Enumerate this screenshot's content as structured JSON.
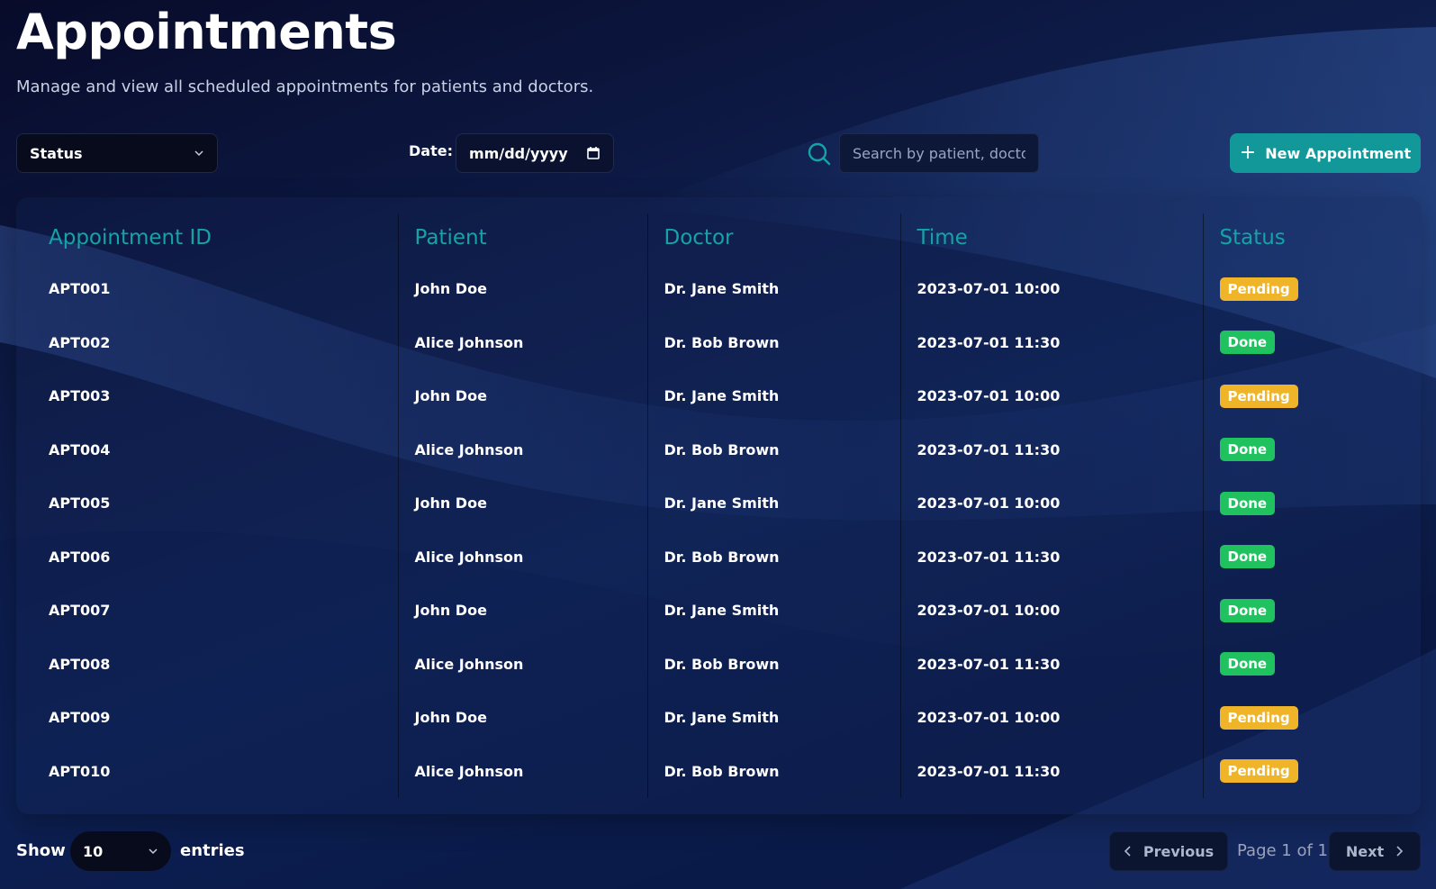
{
  "header": {
    "title": "Appointments",
    "subtitle": "Manage and view all scheduled appointments for patients and doctors."
  },
  "toolbar": {
    "status_filter": {
      "value": "Status",
      "icon": "chevron-down-icon"
    },
    "date_label": "Date:",
    "date_value": "mm/dd/yyyy",
    "date_icon": "calendar-icon",
    "search_icon": "search-icon",
    "search_placeholder": "Search by patient, doctor",
    "new_button_icon": "plus-icon",
    "new_button_label": "New Appointment"
  },
  "table": {
    "columns": [
      "Appointment ID",
      "Patient",
      "Doctor",
      "Time",
      "Status"
    ],
    "rows": [
      {
        "id": "APT001",
        "patient": "John Doe",
        "doctor": "Dr. Jane Smith",
        "time": "2023-07-01 10:00",
        "status": "Pending"
      },
      {
        "id": "APT002",
        "patient": "Alice Johnson",
        "doctor": "Dr. Bob Brown",
        "time": "2023-07-01 11:30",
        "status": "Done"
      },
      {
        "id": "APT003",
        "patient": "John Doe",
        "doctor": "Dr. Jane Smith",
        "time": "2023-07-01 10:00",
        "status": "Pending"
      },
      {
        "id": "APT004",
        "patient": "Alice Johnson",
        "doctor": "Dr. Bob Brown",
        "time": "2023-07-01 11:30",
        "status": "Done"
      },
      {
        "id": "APT005",
        "patient": "John Doe",
        "doctor": "Dr. Jane Smith",
        "time": "2023-07-01 10:00",
        "status": "Done"
      },
      {
        "id": "APT006",
        "patient": "Alice Johnson",
        "doctor": "Dr. Bob Brown",
        "time": "2023-07-01 11:30",
        "status": "Done"
      },
      {
        "id": "APT007",
        "patient": "John Doe",
        "doctor": "Dr. Jane Smith",
        "time": "2023-07-01 10:00",
        "status": "Done"
      },
      {
        "id": "APT008",
        "patient": "Alice Johnson",
        "doctor": "Dr. Bob Brown",
        "time": "2023-07-01 11:30",
        "status": "Done"
      },
      {
        "id": "APT009",
        "patient": "John Doe",
        "doctor": "Dr. Jane Smith",
        "time": "2023-07-01 10:00",
        "status": "Pending"
      },
      {
        "id": "APT010",
        "patient": "Alice Johnson",
        "doctor": "Dr. Bob Brown",
        "time": "2023-07-01 11:30",
        "status": "Pending"
      }
    ]
  },
  "status_colors": {
    "Pending": "#f0b429",
    "Done": "#1fc25f"
  },
  "colors": {
    "accent": "#13989a",
    "header_text": "#14a3a6"
  },
  "footer": {
    "show_label": "Show",
    "entries_value": "10",
    "entries_label": "entries",
    "previous_label": "Previous",
    "page_info": "Page 1 of 1",
    "next_label": "Next"
  }
}
